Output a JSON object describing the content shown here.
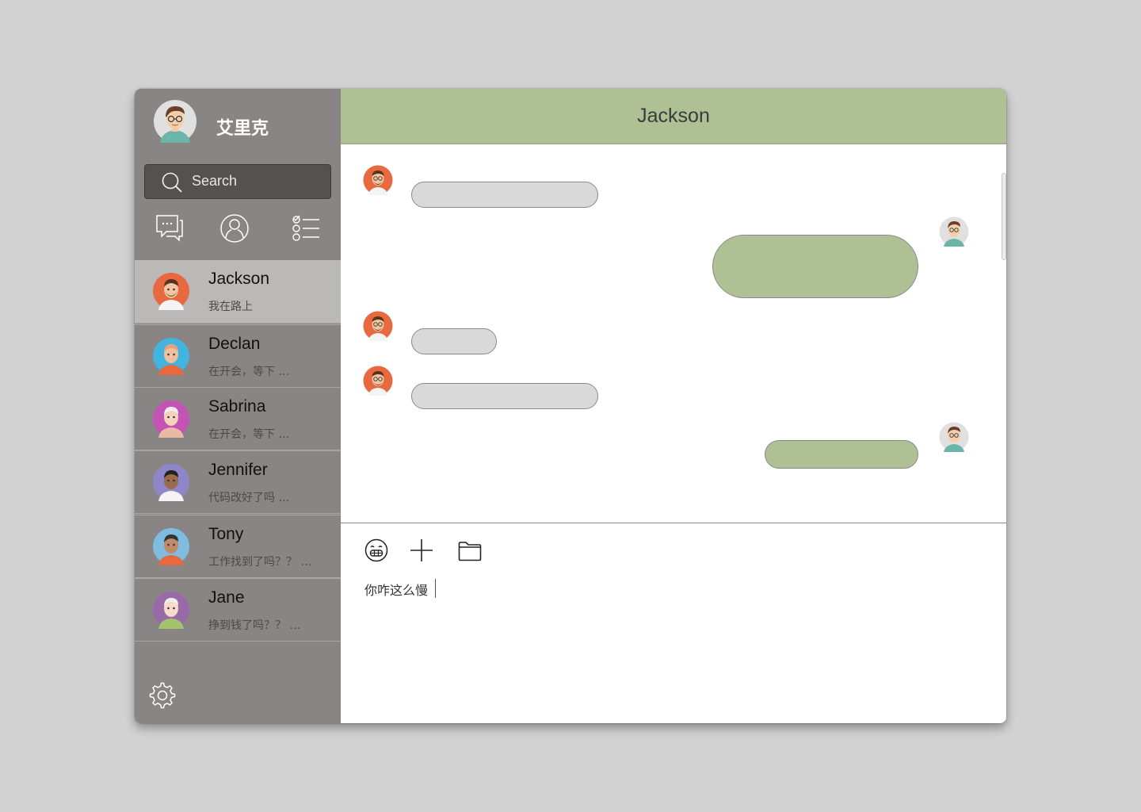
{
  "user": {
    "name": "艾里克",
    "avatar_icon": "user-avatar-glasses-icon"
  },
  "search": {
    "placeholder": "Search",
    "icon": "search-icon"
  },
  "nav": [
    {
      "name": "chats",
      "icon": "chat-bubbles-icon"
    },
    {
      "name": "contacts",
      "icon": "person-icon"
    },
    {
      "name": "tasks",
      "icon": "checklist-icon"
    }
  ],
  "contacts": [
    {
      "name": "Jackson",
      "preview": "我在路上",
      "active": true,
      "avatar_color": "#e8693f"
    },
    {
      "name": "Declan",
      "preview": "在开会，等下 …",
      "active": false,
      "avatar_color": "#43b3e0"
    },
    {
      "name": "Sabrina",
      "preview": "在开会，等下 …",
      "active": false,
      "avatar_color": "#c453b8"
    },
    {
      "name": "Jennifer",
      "preview": "代码改好了吗 …",
      "active": false,
      "avatar_color": "#8e86c8"
    },
    {
      "name": "Tony",
      "preview": "工作找到了吗？？ …",
      "active": false,
      "avatar_color": "#7fbde0"
    },
    {
      "name": "Jane",
      "preview": "挣到钱了吗？？ …",
      "active": false,
      "avatar_color": "#9a6aa6"
    }
  ],
  "chat": {
    "title": "Jackson",
    "messages": [
      {
        "from": "them"
      },
      {
        "from": "me"
      },
      {
        "from": "them"
      },
      {
        "from": "them"
      },
      {
        "from": "me"
      }
    ]
  },
  "composer": {
    "tools": [
      {
        "name": "emoji",
        "icon": "emoji-icon"
      },
      {
        "name": "add",
        "icon": "plus-icon"
      },
      {
        "name": "file",
        "icon": "folder-icon"
      }
    ],
    "draft": "你咋这么慢"
  },
  "settings": {
    "icon": "gear-icon"
  },
  "colors": {
    "sidebar": "#898584",
    "accent_green": "#afc094",
    "incoming_bubble": "#d9d9d9",
    "background": "#d3d2d3"
  }
}
